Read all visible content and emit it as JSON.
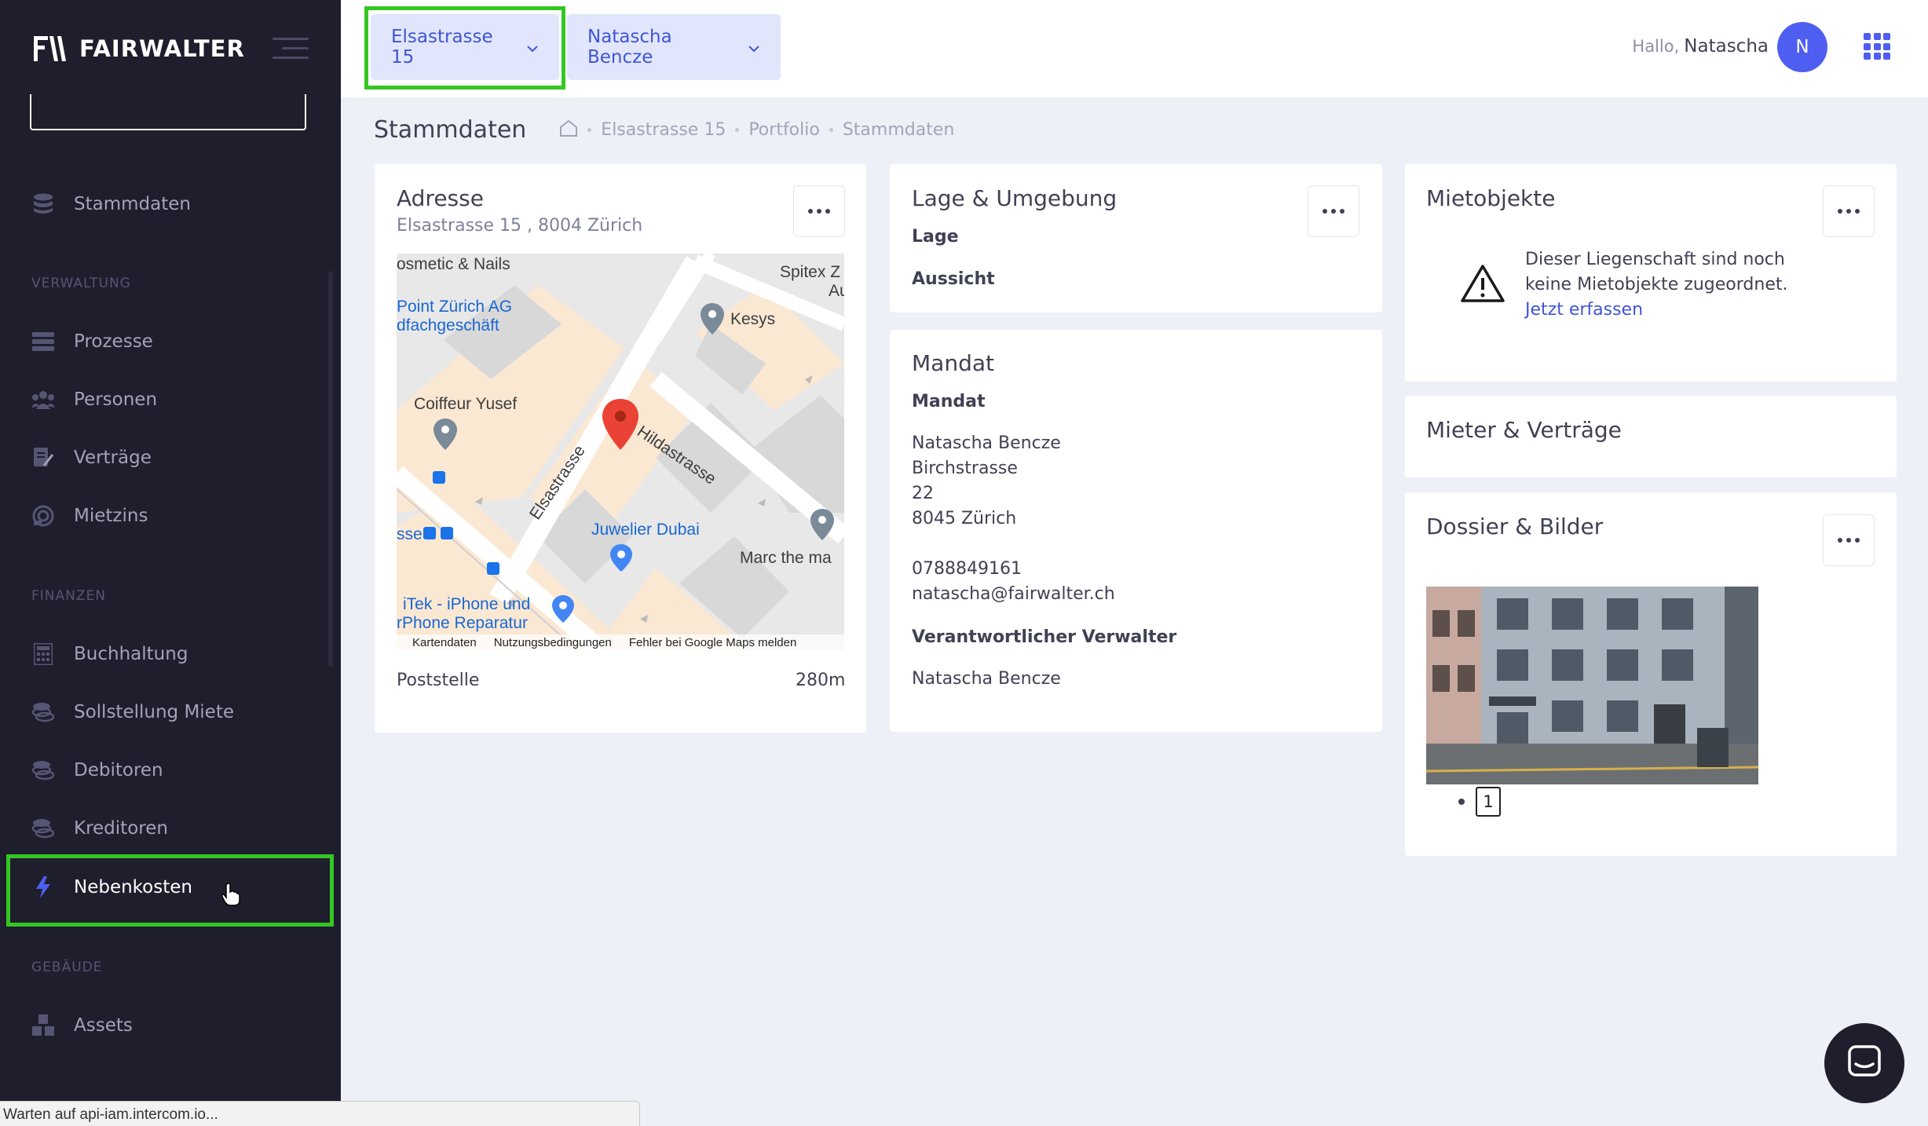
{
  "brand": {
    "name": "FAIRWALTER"
  },
  "sidebar": {
    "top_item": {
      "label": "Stammdaten",
      "icon": "database-icon"
    },
    "sections": [
      {
        "title": "VERWALTUNG",
        "items": [
          {
            "label": "Prozesse",
            "icon": "process-icon"
          },
          {
            "label": "Personen",
            "icon": "people-icon"
          },
          {
            "label": "Verträge",
            "icon": "contract-icon"
          },
          {
            "label": "Mietzins",
            "icon": "rent-icon"
          }
        ]
      },
      {
        "title": "FINANZEN",
        "items": [
          {
            "label": "Buchhaltung",
            "icon": "calculator-icon"
          },
          {
            "label": "Sollstellung Miete",
            "icon": "coins-icon"
          },
          {
            "label": "Debitoren",
            "icon": "coins-icon"
          },
          {
            "label": "Kreditoren",
            "icon": "coins-icon"
          },
          {
            "label": "Nebenkosten",
            "icon": "lightning-icon",
            "active": true
          }
        ]
      },
      {
        "title": "GEBÄUDE",
        "items": [
          {
            "label": "Assets",
            "icon": "cubes-icon"
          }
        ]
      }
    ]
  },
  "topbar": {
    "property_selector": "Elsastrasse 15",
    "user_selector": "Natascha Bencze",
    "greeting": "Hallo,",
    "username": "Natascha",
    "avatar_initial": "N"
  },
  "subheader": {
    "title": "Stammdaten",
    "breadcrumbs": [
      "Elsastrasse 15",
      "Portfolio",
      "Stammdaten"
    ]
  },
  "adresse": {
    "title": "Adresse",
    "subtitle": "Elsastrasse 15 , 8004 Zürich",
    "map": {
      "labels": [
        "osmetic & Nails",
        "Spitex Z",
        "Au",
        "Point Zürich AG",
        "dfachgeschäft",
        "Kesys",
        "Coiffeur Yusef",
        "Hildastrasse",
        "Elsastrasse",
        "Juwelier Dubai",
        "Marc the ma",
        "sse",
        "iTek - iPhone und",
        "rPhone Reparatur"
      ],
      "footer": [
        "Kartendaten",
        "Nutzungsbedingungen",
        "Fehler bei Google Maps melden"
      ]
    },
    "poi_name": "Poststelle",
    "poi_distance": "280m"
  },
  "lage": {
    "title": "Lage & Umgebung",
    "field1": "Lage",
    "field2": "Aussicht"
  },
  "mandat": {
    "title": "Mandat",
    "label": "Mandat",
    "name": "Natascha Bencze",
    "street": "Birchstrasse",
    "number": "22",
    "city": "8045 Zürich",
    "phone": "0788849161",
    "email": "natascha@fairwalter.ch",
    "verwalter_label": "Verantwortlicher Verwalter",
    "verwalter_name": "Natascha Bencze"
  },
  "mietobjekte": {
    "title": "Mietobjekte",
    "message_line1": "Dieser Liegenschaft sind noch",
    "message_line2": "keine Mietobjekte zugeordnet.",
    "link": "Jetzt erfassen"
  },
  "mieter": {
    "title": "Mieter & Verträge"
  },
  "dossier": {
    "title": "Dossier & Bilder",
    "page": "1"
  },
  "status_bar": "Warten auf api-iam.intercom.io...",
  "colors": {
    "accent": "#3f55d6",
    "sidebar": "#1e1e2d",
    "highlight": "#34c724",
    "avatar": "#4e5ef0"
  }
}
